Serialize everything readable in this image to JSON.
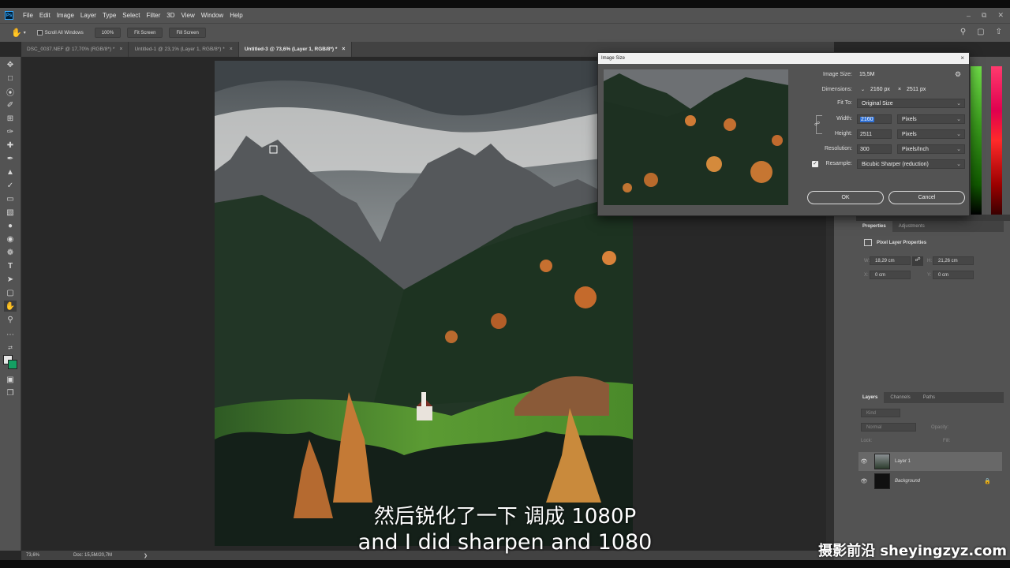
{
  "menubar": {
    "logo": "Ps",
    "items": [
      "File",
      "Edit",
      "Image",
      "Layer",
      "Type",
      "Select",
      "Filter",
      "3D",
      "View",
      "Window",
      "Help"
    ]
  },
  "options": {
    "scroll_all_windows": "Scroll All Windows",
    "zoom_btn": "100%",
    "fit_screen": "Fit Screen",
    "fill_screen": "Fill Screen"
  },
  "tabs": [
    {
      "label": "DSC_0037.NEF @ 17,70% (RGB/8*) *"
    },
    {
      "label": "Untitled-1 @ 23,1% (Layer 1, RGB/8*) *"
    },
    {
      "label": "Untitled-3 @ 73,6% (Layer 1, RGB/8*) *"
    }
  ],
  "status": {
    "zoom": "73,6%",
    "doc": "Doc: 15,5M/20,7M"
  },
  "dialog": {
    "title": "Image Size",
    "image_size_label": "Image Size:",
    "image_size_value": "15,5M",
    "dimensions_label": "Dimensions:",
    "dim_w": "2160 px",
    "dim_x": "×",
    "dim_h": "2511 px",
    "fit_to_label": "Fit To:",
    "fit_to_value": "Original Size",
    "width_label": "Width:",
    "width_value": "2160",
    "width_unit": "Pixels",
    "height_label": "Height:",
    "height_value": "2511",
    "height_unit": "Pixels",
    "resolution_label": "Resolution:",
    "resolution_value": "300",
    "resolution_unit": "Pixels/Inch",
    "resample_label": "Resample:",
    "resample_value": "Bicubic Sharper (reduction)",
    "ok": "OK",
    "cancel": "Cancel"
  },
  "properties": {
    "tabs": [
      "Properties",
      "Adjustments"
    ],
    "title": "Pixel Layer Properties",
    "w_label": "W:",
    "w": "18,29 cm",
    "h_label": "H:",
    "h": "21,26 cm",
    "x_label": "X:",
    "x": "0 cm",
    "y_label": "Y:",
    "y": "0 cm"
  },
  "layers": {
    "tabs": [
      "Layers",
      "Channels",
      "Paths"
    ],
    "kind": "Kind",
    "blend": "Normal",
    "opacity": "Opacity:",
    "lock": "Lock:",
    "fill": "Fill:",
    "items": [
      {
        "name": "Layer 1"
      },
      {
        "name": "Background"
      }
    ]
  },
  "subtitles": {
    "zh": "然后锐化了一下 调成 1080P",
    "en": "and I did sharpen and 1080"
  },
  "watermark": "摄影前沿 sheyingzyz.com",
  "colors": {
    "accent": "#31a8ff",
    "panel": "#535353",
    "dark": "#282828"
  }
}
